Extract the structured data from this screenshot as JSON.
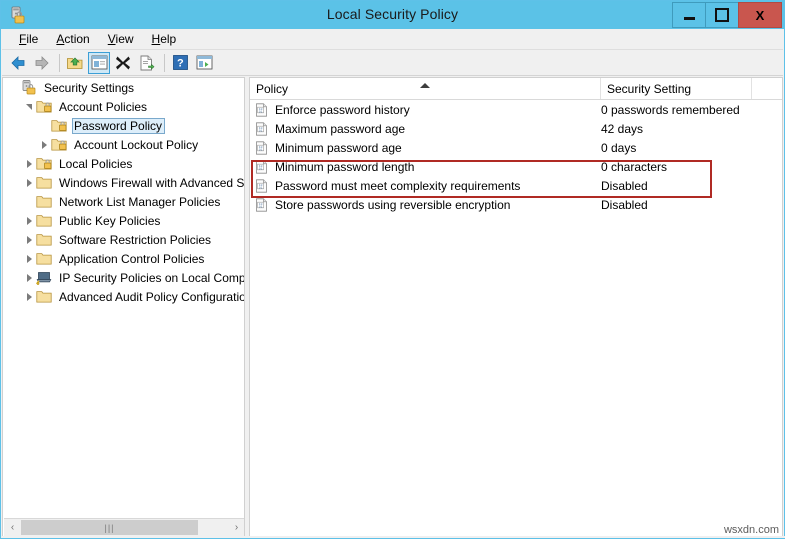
{
  "window": {
    "title": "Local Security Policy",
    "icon": "security-policy-icon",
    "controls": {
      "minimize": "minimize-icon",
      "maximize": "maximize-icon",
      "close": "X"
    },
    "titlebar_color": "#5bc2e7",
    "close_color": "#c9564e"
  },
  "menubar": {
    "items": [
      {
        "label": "File",
        "accel": "F"
      },
      {
        "label": "Action",
        "accel": "A"
      },
      {
        "label": "View",
        "accel": "V"
      },
      {
        "label": "Help",
        "accel": "H"
      }
    ]
  },
  "toolbar": {
    "buttons": [
      {
        "name": "back-icon",
        "active": false
      },
      {
        "name": "forward-icon",
        "active": false
      },
      {
        "name": "up-folder-icon",
        "active": false
      },
      {
        "name": "show-hide-tree-icon",
        "active": true
      },
      {
        "name": "delete-icon",
        "active": false
      },
      {
        "name": "export-list-icon",
        "active": false
      },
      {
        "name": "help-icon",
        "active": false
      },
      {
        "name": "properties-window-icon",
        "active": false
      }
    ]
  },
  "tree": {
    "items": [
      {
        "label": "Security Settings",
        "depth": 0,
        "expander": "none",
        "icon": "security-settings-icon",
        "selected": false
      },
      {
        "label": "Account Policies",
        "depth": 1,
        "expander": "expanded",
        "icon": "policy-folder-icon",
        "selected": false
      },
      {
        "label": "Password Policy",
        "depth": 2,
        "expander": "none",
        "icon": "policy-folder-icon",
        "selected": true
      },
      {
        "label": "Account Lockout Policy",
        "depth": 2,
        "expander": "collapsed",
        "icon": "policy-folder-icon",
        "selected": false
      },
      {
        "label": "Local Policies",
        "depth": 1,
        "expander": "collapsed",
        "icon": "policy-folder-icon",
        "selected": false
      },
      {
        "label": "Windows Firewall with Advanced Secu",
        "depth": 1,
        "expander": "collapsed",
        "icon": "folder-icon",
        "selected": false
      },
      {
        "label": "Network List Manager Policies",
        "depth": 1,
        "expander": "none",
        "icon": "folder-icon",
        "selected": false
      },
      {
        "label": "Public Key Policies",
        "depth": 1,
        "expander": "collapsed",
        "icon": "folder-icon",
        "selected": false
      },
      {
        "label": "Software Restriction Policies",
        "depth": 1,
        "expander": "collapsed",
        "icon": "folder-icon",
        "selected": false
      },
      {
        "label": "Application Control Policies",
        "depth": 1,
        "expander": "collapsed",
        "icon": "folder-icon",
        "selected": false
      },
      {
        "label": "IP Security Policies on Local Compute",
        "depth": 1,
        "expander": "collapsed",
        "icon": "ip-security-icon",
        "selected": false
      },
      {
        "label": "Advanced Audit Policy Configuration",
        "depth": 1,
        "expander": "collapsed",
        "icon": "folder-icon",
        "selected": false
      }
    ],
    "scrollbar": {
      "left_arrow": "‹",
      "right_arrow": "›",
      "grip": "|||"
    }
  },
  "list": {
    "columns": [
      {
        "label": "Policy",
        "sorted": "ascending"
      },
      {
        "label": "Security Setting",
        "sorted": "none"
      },
      {
        "label": "",
        "sorted": "none"
      }
    ],
    "rows": [
      {
        "policy": "Enforce password history",
        "setting": "0 passwords remembered",
        "icon": "policy-item-icon"
      },
      {
        "policy": "Maximum password age",
        "setting": "42 days",
        "icon": "policy-item-icon"
      },
      {
        "policy": "Minimum password age",
        "setting": "0 days",
        "icon": "policy-item-icon"
      },
      {
        "policy": "Minimum password length",
        "setting": "0 characters",
        "icon": "policy-item-icon"
      },
      {
        "policy": "Password must meet complexity requirements",
        "setting": "Disabled",
        "icon": "policy-item-icon"
      },
      {
        "policy": "Store passwords using reversible encryption",
        "setting": "Disabled",
        "icon": "policy-item-icon"
      }
    ]
  },
  "annotation": {
    "color": "#b02a24",
    "covers_rows": [
      "Minimum password length",
      "Password must meet complexity requirements"
    ]
  },
  "watermark": {
    "text": "wsxdn.com"
  }
}
